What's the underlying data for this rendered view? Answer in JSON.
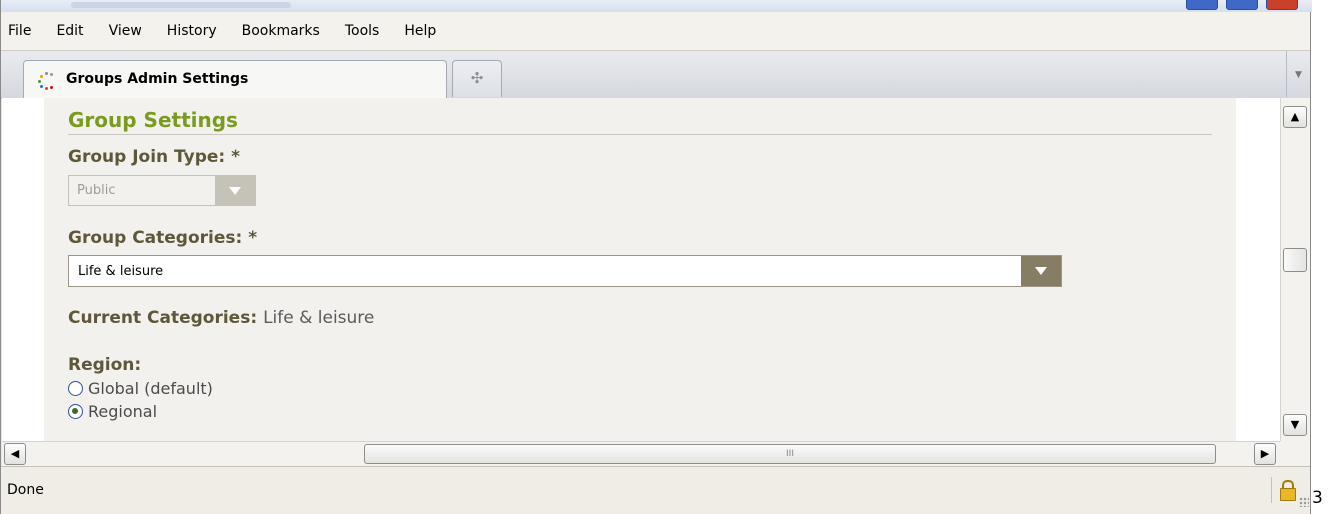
{
  "menubar": {
    "items": [
      "File",
      "Edit",
      "View",
      "History",
      "Bookmarks",
      "Tools",
      "Help"
    ]
  },
  "tabs": {
    "active_title": "Groups Admin Settings",
    "new_tab_symbol": "✣",
    "list_symbol": "▼"
  },
  "form": {
    "section_heading": "Group Settings",
    "join_type": {
      "label": "Group Join Type: *",
      "value": "Public",
      "disabled": true
    },
    "categories": {
      "label": "Group Categories: *",
      "value": "Life & leisure"
    },
    "current_categories": {
      "label": "Current Categories:",
      "value": "Life & leisure"
    },
    "region": {
      "label": "Region:",
      "options": [
        {
          "label": "Global (default)",
          "checked": false
        },
        {
          "label": "Regional",
          "checked": true
        }
      ]
    }
  },
  "scrollbar": {
    "up": "▲",
    "down": "▼",
    "left": "◀",
    "right": "▶",
    "grip": "III"
  },
  "statusbar": {
    "text": "Done"
  },
  "edge_text": "3",
  "colors": {
    "heading": "#7a9a20",
    "label": "#5f573a",
    "dropdown_button": "#857d64",
    "content_bg": "#f2f1ed"
  },
  "icons": [
    "favicon-icon",
    "new-tab-icon",
    "tab-list-icon",
    "dropdown-arrow-icon",
    "lock-icon",
    "resize-grip-icon"
  ]
}
